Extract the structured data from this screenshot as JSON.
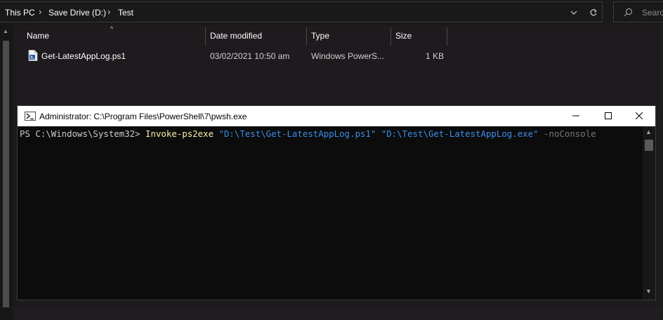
{
  "explorer": {
    "breadcrumb": [
      {
        "label": "This PC"
      },
      {
        "label": "Save Drive (D:)"
      },
      {
        "label": "Test"
      }
    ],
    "search_placeholder": "Search Test",
    "columns": {
      "name": "Name",
      "date_modified": "Date modified",
      "type": "Type",
      "size": "Size"
    },
    "files": [
      {
        "name": "Get-LatestAppLog.ps1",
        "date_modified": "03/02/2021 10:50 am",
        "type": "Windows PowerS...",
        "size": "1 KB",
        "icon": "powershell-script-icon"
      }
    ]
  },
  "powershell": {
    "title": "Administrator: C:\\Program Files\\PowerShell\\7\\pwsh.exe",
    "command": {
      "prompt": "PS C:\\Windows\\System32> ",
      "cmdlet": "Invoke-ps2exe",
      "arg1": "\"D:\\Test\\Get-LatestAppLog.ps1\"",
      "arg2": "\"D:\\Test\\Get-LatestAppLog.exe\"",
      "param": "-noConsole"
    },
    "window_buttons": [
      "minimize-icon",
      "maximize-icon",
      "close-icon"
    ]
  },
  "colors": {
    "prompt": "#cccccc",
    "cmdlet": "#f9f1a5",
    "string": "#3b8eea",
    "parameter": "#767676"
  }
}
